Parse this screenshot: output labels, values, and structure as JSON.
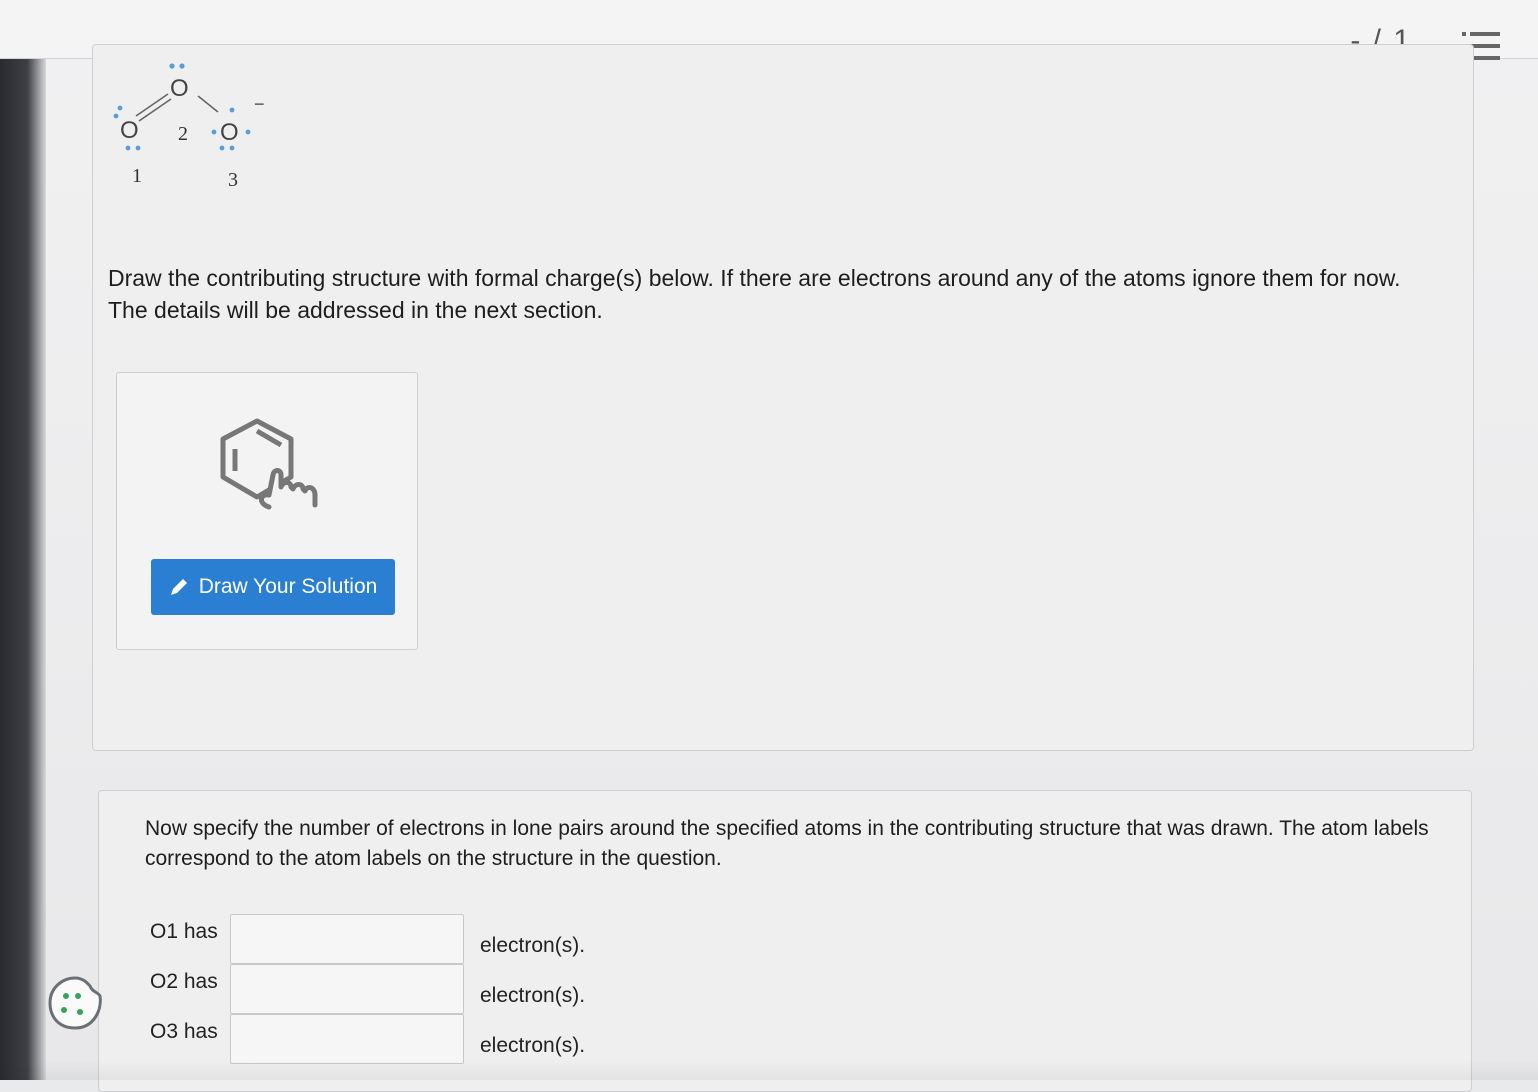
{
  "header": {
    "score": "- / 1",
    "menu_icon": "list-icon"
  },
  "molecule": {
    "atom_symbol": "O",
    "charge": "−",
    "labels": [
      "1",
      "2",
      "3"
    ]
  },
  "part1": {
    "prompt_line1": "Draw the contributing structure with formal charge(s) below. If there are electrons around any of the atoms ignore them for now.",
    "prompt_line2": "The details will be addressed in the next section.",
    "draw_button_label": "Draw Your Solution",
    "draw_icon": "pencil-icon"
  },
  "part2": {
    "prompt": "Now specify the number of electrons in lone pairs around the specified atoms in the contributing structure that was drawn. The atom labels correspond to the atom labels on the structure in the question.",
    "rows": [
      {
        "label": "O1 has",
        "value": "",
        "unit": "electron(s)."
      },
      {
        "label": "O2 has",
        "value": "",
        "unit": "electron(s)."
      },
      {
        "label": "O3 has",
        "value": "",
        "unit": "electron(s)."
      }
    ]
  },
  "colors": {
    "button_blue": "#2a7fd2",
    "lone_pair_blue": "#5a9bd8",
    "cookie_green": "#3aa35a"
  }
}
